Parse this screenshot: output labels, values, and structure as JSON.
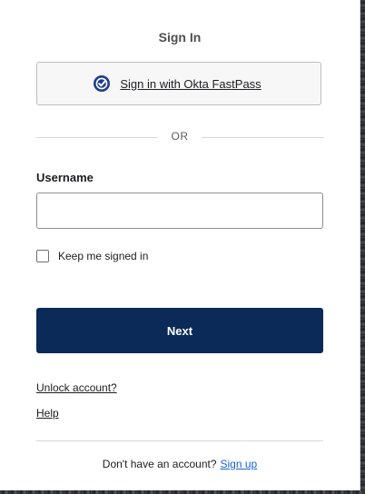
{
  "title": "Sign In",
  "fastpass": {
    "label": "Sign in with Okta FastPass",
    "icon": "check-circle-icon",
    "icon_color": "#1d3d8f"
  },
  "divider_text": "OR",
  "username": {
    "label": "Username",
    "value": "",
    "placeholder": ""
  },
  "keep_signed_in": {
    "label": "Keep me signed in",
    "checked": false
  },
  "next_button": {
    "label": "Next",
    "color": "#0b2a58"
  },
  "links": {
    "unlock": "Unlock account?",
    "help": "Help"
  },
  "signup": {
    "prompt": "Don't have an account?",
    "link": "Sign up",
    "link_color": "#1662dd"
  }
}
